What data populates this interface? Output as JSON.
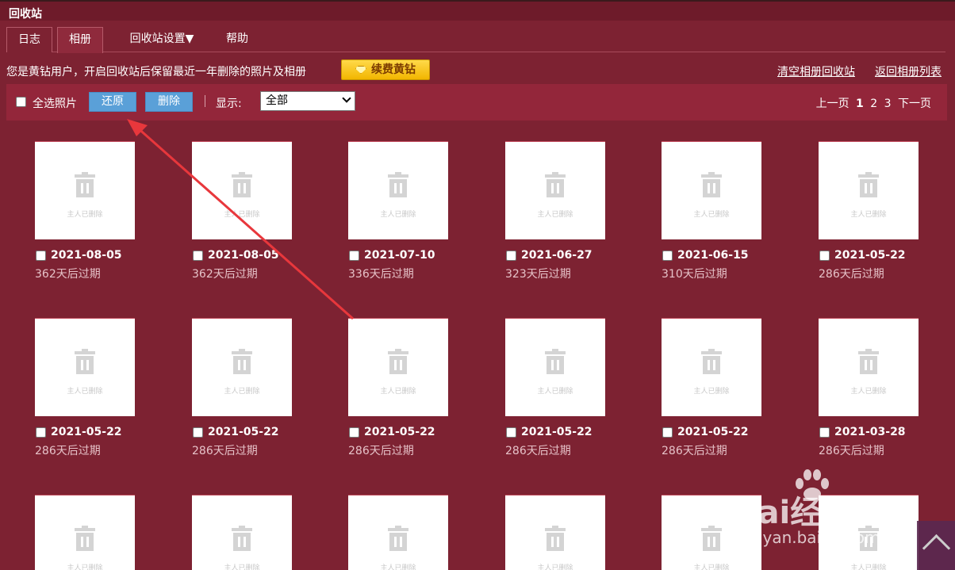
{
  "window": {
    "title": "回收站"
  },
  "tabs": [
    {
      "label": "日志"
    },
    {
      "label": "相册"
    },
    {
      "label": "回收站设置▼"
    },
    {
      "label": "帮助"
    }
  ],
  "notice": {
    "text": "您是黄钻用户，开启回收站后保留最近一年删除的照片及相册",
    "vip_button": "续费黄钻"
  },
  "links": {
    "clear": "清空相册回收站",
    "back": "返回相册列表"
  },
  "toolbar": {
    "select_all": "全选照片",
    "restore": "还原",
    "delete": "删除",
    "show_label": "显示:",
    "show_value": "全部"
  },
  "pager": {
    "prev": "上一页",
    "pages": [
      "1",
      "2",
      "3"
    ],
    "current": "1",
    "next": "下一页"
  },
  "photos": [
    {
      "date": "2021-08-05",
      "expire": "362天后过期"
    },
    {
      "date": "2021-08-05",
      "expire": "362天后过期"
    },
    {
      "date": "2021-07-10",
      "expire": "336天后过期"
    },
    {
      "date": "2021-06-27",
      "expire": "323天后过期"
    },
    {
      "date": "2021-06-15",
      "expire": "310天后过期"
    },
    {
      "date": "2021-05-22",
      "expire": "286天后过期"
    },
    {
      "date": "2021-05-22",
      "expire": "286天后过期"
    },
    {
      "date": "2021-05-22",
      "expire": "286天后过期"
    },
    {
      "date": "2021-05-22",
      "expire": "286天后过期"
    },
    {
      "date": "2021-05-22",
      "expire": "286天后过期"
    },
    {
      "date": "2021-05-22",
      "expire": "286天后过期"
    },
    {
      "date": "2021-03-28",
      "expire": "286天后过期"
    }
  ],
  "placeholder_text": "主人已删除",
  "watermark": {
    "text": "Bai经验",
    "sub": "jingyan.baidu.com"
  }
}
